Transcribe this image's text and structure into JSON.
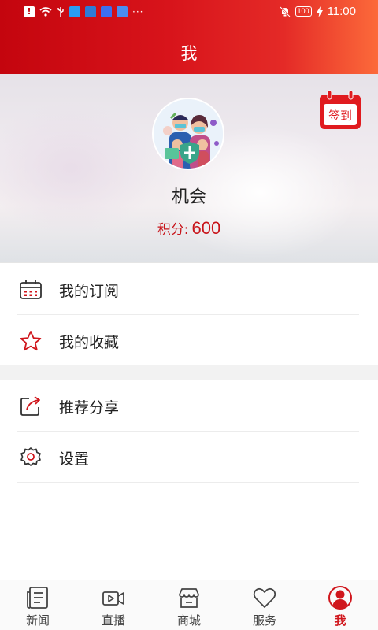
{
  "status_bar": {
    "battery": "100",
    "time": "11:00",
    "dots": "···"
  },
  "header": {
    "title": "我"
  },
  "profile": {
    "avatar_icon": "family-masks-avatar-icon",
    "name": "机会",
    "points_label": "积分:",
    "points_value": "600",
    "checkin_label": "签到"
  },
  "menu": {
    "group1": [
      {
        "label": "我的订阅",
        "icon": "calendar-icon"
      },
      {
        "label": "我的收藏",
        "icon": "star-icon"
      }
    ],
    "group2": [
      {
        "label": "推荐分享",
        "icon": "share-icon"
      },
      {
        "label": "设置",
        "icon": "gear-icon"
      }
    ]
  },
  "tabs": [
    {
      "label": "新闻",
      "icon": "news-icon"
    },
    {
      "label": "直播",
      "icon": "video-icon"
    },
    {
      "label": "商城",
      "icon": "store-icon"
    },
    {
      "label": "服务",
      "icon": "heart-icon"
    },
    {
      "label": "我",
      "icon": "user-icon",
      "active": true
    }
  ],
  "colors": {
    "brand_red": "#d0161c",
    "header_start": "#c4050e",
    "header_end": "#fc6a3a"
  }
}
